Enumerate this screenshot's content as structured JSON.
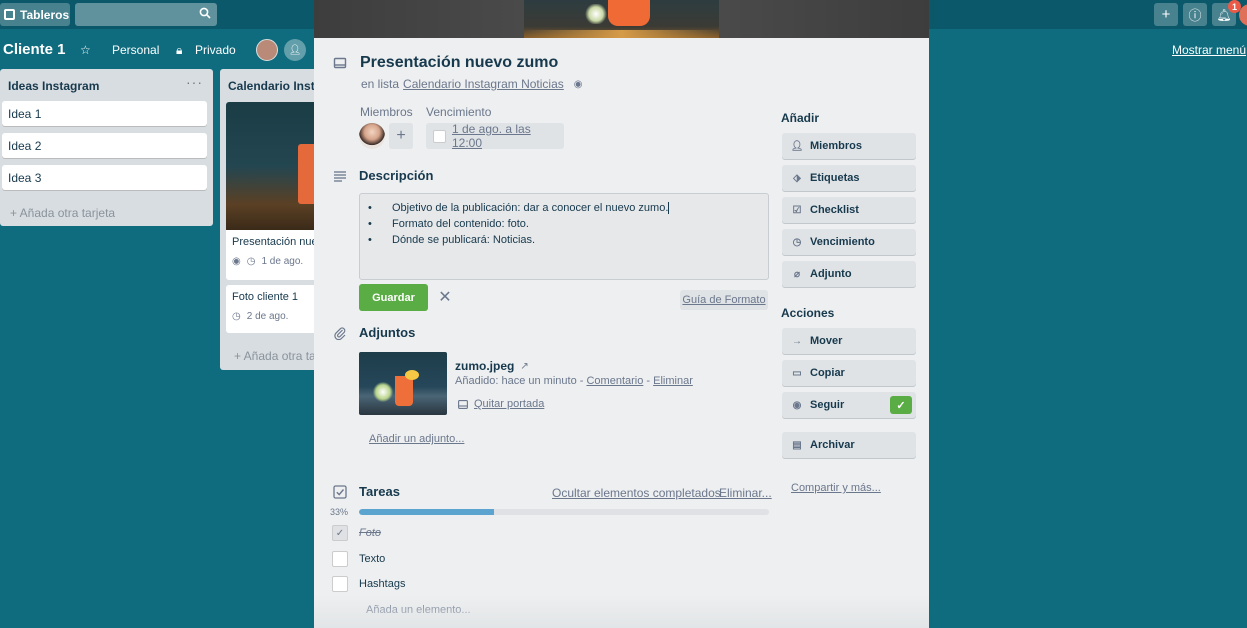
{
  "topbar": {
    "boards_label": "Tableros",
    "notif_count": "1"
  },
  "board": {
    "title": "Cliente 1",
    "visibility_team": "Personal",
    "visibility_privacy": "Privado",
    "show_menu": "Mostrar menú"
  },
  "lists": [
    {
      "title": "Ideas Instagram",
      "cards": [
        "Idea 1",
        "Idea 2",
        "Idea 3"
      ],
      "add_card": "+ Añada otra tarjeta"
    },
    {
      "title": "Calendario Instagram Noticias",
      "cards": [
        {
          "title": "Presentación nuevo zumo",
          "due": "1 de ago."
        },
        {
          "title": "Foto cliente 1",
          "due": "2 de ago."
        }
      ],
      "add_card": "+ Añada otra tarjeta"
    }
  ],
  "card": {
    "title": "Presentación nuevo zumo",
    "in_list_prefix": "en lista",
    "list_name": "Calendario Instagram Noticias",
    "members_label": "Miembros",
    "due_label": "Vencimiento",
    "due_value": "1 de ago. a las 12:00",
    "description_title": "Descripción",
    "description_lines": [
      "Objetivo de la publicación: dar a conocer el nuevo zumo.",
      "Formato del contenido: foto.",
      "Dónde se publicará: Noticias."
    ],
    "save_label": "Guardar",
    "format_guide": "Guía de Formato",
    "attachments_title": "Adjuntos",
    "attachment": {
      "name": "zumo.jpeg",
      "added": "Añadido: hace un minuto",
      "comment": "Comentario",
      "delete": "Eliminar",
      "remove_cover": "Quitar portada"
    },
    "add_attachment": "Añadir un adjunto...",
    "checklist": {
      "title": "Tareas",
      "hide_completed": "Ocultar elementos completados",
      "delete": "Eliminar...",
      "percent_label": "33%",
      "progress": 0.33,
      "items": [
        {
          "label": "Foto",
          "done": true
        },
        {
          "label": "Texto",
          "done": false
        },
        {
          "label": "Hashtags",
          "done": false
        }
      ],
      "add_item": "Añada un elemento..."
    }
  },
  "sidebar": {
    "add_title": "Añadir",
    "add_buttons": [
      "Miembros",
      "Etiquetas",
      "Checklist",
      "Vencimiento",
      "Adjunto"
    ],
    "actions_title": "Acciones",
    "action_buttons": [
      "Mover",
      "Copiar",
      "Seguir"
    ],
    "archive": "Archivar",
    "share_more": "Compartir y más..."
  },
  "colors": {
    "board_bg": "#0e6c7e",
    "save_green": "#5aac44",
    "progress_blue": "#5ba4cf",
    "notif_red": "#eb5a46"
  }
}
